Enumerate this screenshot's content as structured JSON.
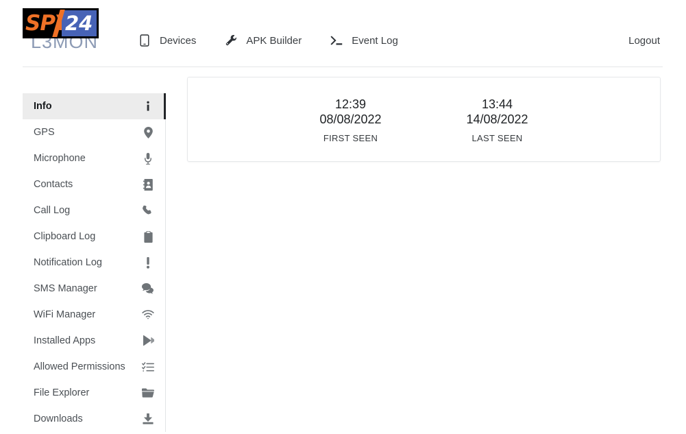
{
  "header": {
    "brand": {
      "logo_spy": "SPY",
      "logo_number": "24",
      "product_word": "L3MON",
      "logo_colors": {
        "orange": "#ef7126",
        "blue": "#4763b6",
        "black": "#000000",
        "word_color": "#8d9bb5"
      }
    },
    "nav": [
      {
        "label": "Devices",
        "icon": "mobile-phone-icon"
      },
      {
        "label": "APK Builder",
        "icon": "wrench-icon"
      },
      {
        "label": "Event Log",
        "icon": "terminal-prompt-icon"
      }
    ],
    "logout_label": "Logout"
  },
  "sidebar": {
    "active_index": 0,
    "items": [
      {
        "label": "Info",
        "icon": "info-icon"
      },
      {
        "label": "GPS",
        "icon": "map-pin-icon"
      },
      {
        "label": "Microphone",
        "icon": "microphone-icon"
      },
      {
        "label": "Contacts",
        "icon": "contact-book-icon"
      },
      {
        "label": "Call Log",
        "icon": "phone-handset-icon"
      },
      {
        "label": "Clipboard Log",
        "icon": "clipboard-icon"
      },
      {
        "label": "Notification Log",
        "icon": "exclamation-icon"
      },
      {
        "label": "SMS Manager",
        "icon": "chat-bubbles-icon"
      },
      {
        "label": "WiFi Manager",
        "icon": "wifi-icon"
      },
      {
        "label": "Installed Apps",
        "icon": "play-store-icon"
      },
      {
        "label": "Allowed Permissions",
        "icon": "checklist-icon"
      },
      {
        "label": "File Explorer",
        "icon": "folder-icon"
      },
      {
        "label": "Downloads",
        "icon": "download-icon"
      }
    ]
  },
  "main": {
    "stats": [
      {
        "time": "12:39",
        "date": "08/08/2022",
        "label": "FIRST SEEN"
      },
      {
        "time": "13:44",
        "date": "14/08/2022",
        "label": "LAST SEEN"
      }
    ]
  }
}
